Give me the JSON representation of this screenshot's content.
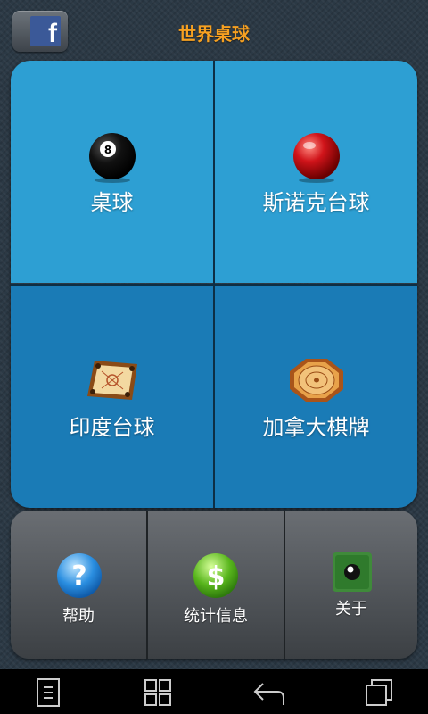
{
  "header": {
    "title": "世界桌球",
    "facebook_icon": "facebook-icon",
    "facebook_glyph": "f"
  },
  "games": [
    {
      "label": "桌球",
      "icon": "eight-ball-icon",
      "icon_glyph": "8"
    },
    {
      "label": "斯诺克台球",
      "icon": "red-snooker-ball-icon"
    },
    {
      "label": "印度台球",
      "icon": "carrom-board-icon"
    },
    {
      "label": "加拿大棋牌",
      "icon": "crokinole-board-icon"
    }
  ],
  "menu": [
    {
      "label": "帮助",
      "icon": "question-icon",
      "icon_glyph": "?"
    },
    {
      "label": "统计信息",
      "icon": "dollar-icon",
      "icon_glyph": "$"
    },
    {
      "label": "关于",
      "icon": "eight-ball-about-icon"
    }
  ],
  "navbar": {
    "icons": [
      "menu-icon",
      "home-icon",
      "back-icon",
      "recent-apps-icon"
    ]
  },
  "colors": {
    "title": "#f6a021",
    "tile_top": "#2d9fd3",
    "tile_bottom": "#1a7bb6",
    "facebook": "#3b5998"
  }
}
